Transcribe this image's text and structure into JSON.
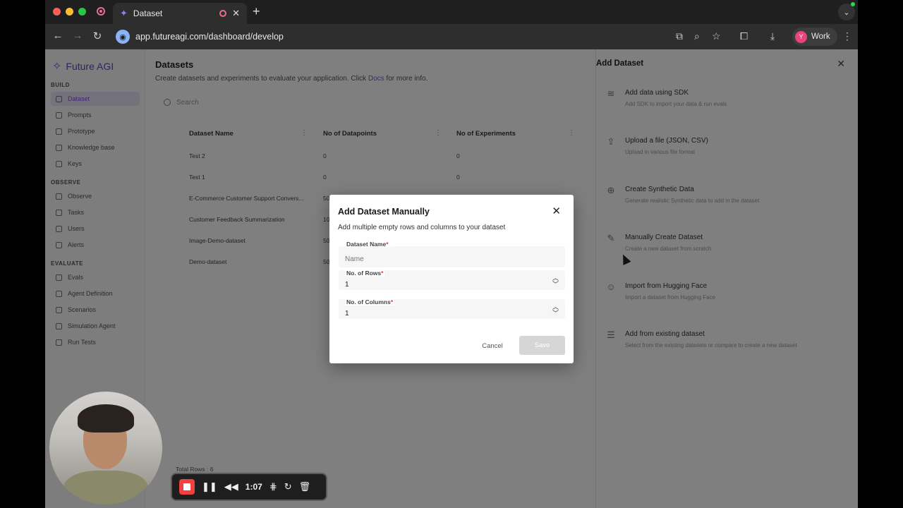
{
  "browser": {
    "tab_title": "Dataset",
    "url": "app.futureagi.com/dashboard/develop",
    "profile_label": "Work",
    "profile_initial": "Y"
  },
  "sidebar": {
    "brand": "Future AGI",
    "sections": [
      {
        "label": "BUILD",
        "items": [
          "Dataset",
          "Prompts",
          "Prototype",
          "Knowledge base",
          "Keys"
        ]
      },
      {
        "label": "OBSERVE",
        "items": [
          "Observe",
          "Tasks",
          "Users",
          "Alerts"
        ]
      },
      {
        "label": "EVALUATE",
        "items": [
          "Evals",
          "Agent Definition",
          "Scenarios",
          "Simulation Agent",
          "Run Tests"
        ]
      }
    ],
    "active": "Dataset"
  },
  "main": {
    "title": "Datasets",
    "subtitle_prefix": "Create datasets and experiments to evaluate your application. Click ",
    "subtitle_link": "Docs",
    "subtitle_suffix": " for more info.",
    "search_placeholder": "Search",
    "columns": [
      "Dataset Name",
      "No of Datapoints",
      "No of Experiments"
    ],
    "rows": [
      [
        "Test 2",
        "0",
        "0"
      ],
      [
        "Test 1",
        "0",
        "0"
      ],
      [
        "E-Commerce Customer Support Convers...",
        "50",
        ""
      ],
      [
        "Customer Feedback Summarization",
        "10",
        ""
      ],
      [
        "Image-Demo-dataset",
        "50",
        ""
      ],
      [
        "Demo-dataset",
        "50",
        ""
      ]
    ],
    "total_rows": "Total Rows : 6"
  },
  "drawer": {
    "title": "Add Dataset",
    "options": [
      {
        "title": "Add data using SDK",
        "desc": "Add SDK to import your data & run evals",
        "icon": "layers-icon",
        "glyph": "≋"
      },
      {
        "title": "Upload a file (JSON, CSV)",
        "desc": "Upload in various file format",
        "icon": "upload-icon",
        "glyph": "⇪"
      },
      {
        "title": "Create Synthetic Data",
        "desc": "Generate realistic Synthetic data to add in the dataset",
        "icon": "plus-circle-icon",
        "glyph": "⊕"
      },
      {
        "title": "Manually Create Dataset",
        "desc": "Create a new dataset from scratch",
        "icon": "hand-icon",
        "glyph": "✎"
      },
      {
        "title": "Import from Hugging Face",
        "desc": "Import a dataset from Hugging Face",
        "icon": "hugging-face-icon",
        "glyph": "☺"
      },
      {
        "title": "Add from existing dataset",
        "desc": "Select from the existing datasets or compare to create a new dataset",
        "icon": "list-icon",
        "glyph": "☰"
      }
    ]
  },
  "modal": {
    "title": "Add Dataset Manually",
    "subtitle": "Add multiple empty rows and columns to your dataset",
    "name_label": "Dataset Name",
    "name_placeholder": "Name",
    "rows_label": "No. of Rows",
    "rows_value": "1",
    "cols_label": "No. of Columns",
    "cols_value": "1",
    "required_mark": "*",
    "cancel_label": "Cancel",
    "save_label": "Save"
  },
  "recording": {
    "time": "1:07"
  },
  "colors": {
    "brand": "#7b4ce0",
    "record": "#f04040"
  }
}
